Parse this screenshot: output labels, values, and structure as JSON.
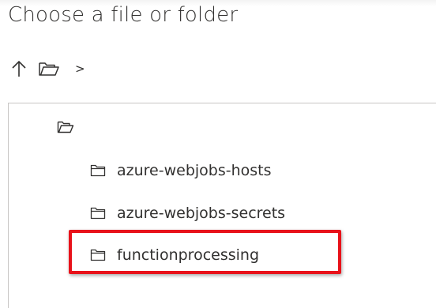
{
  "dialog": {
    "title": "Choose a file or folder"
  },
  "toolbar": {
    "up_icon": "arrow-up-icon",
    "folder_icon": "open-folder-icon",
    "breadcrumb_separator": ">"
  },
  "tree": {
    "root_icon": "open-folder-icon",
    "items": [
      {
        "label": "azure-webjobs-hosts",
        "icon": "folder-icon"
      },
      {
        "label": "azure-webjobs-secrets",
        "icon": "folder-icon"
      },
      {
        "label": "functionprocessing",
        "icon": "folder-icon",
        "highlighted": true
      }
    ]
  },
  "colors": {
    "text": "#323130",
    "border": "#c8c6c4",
    "highlight": "#e8121a"
  }
}
